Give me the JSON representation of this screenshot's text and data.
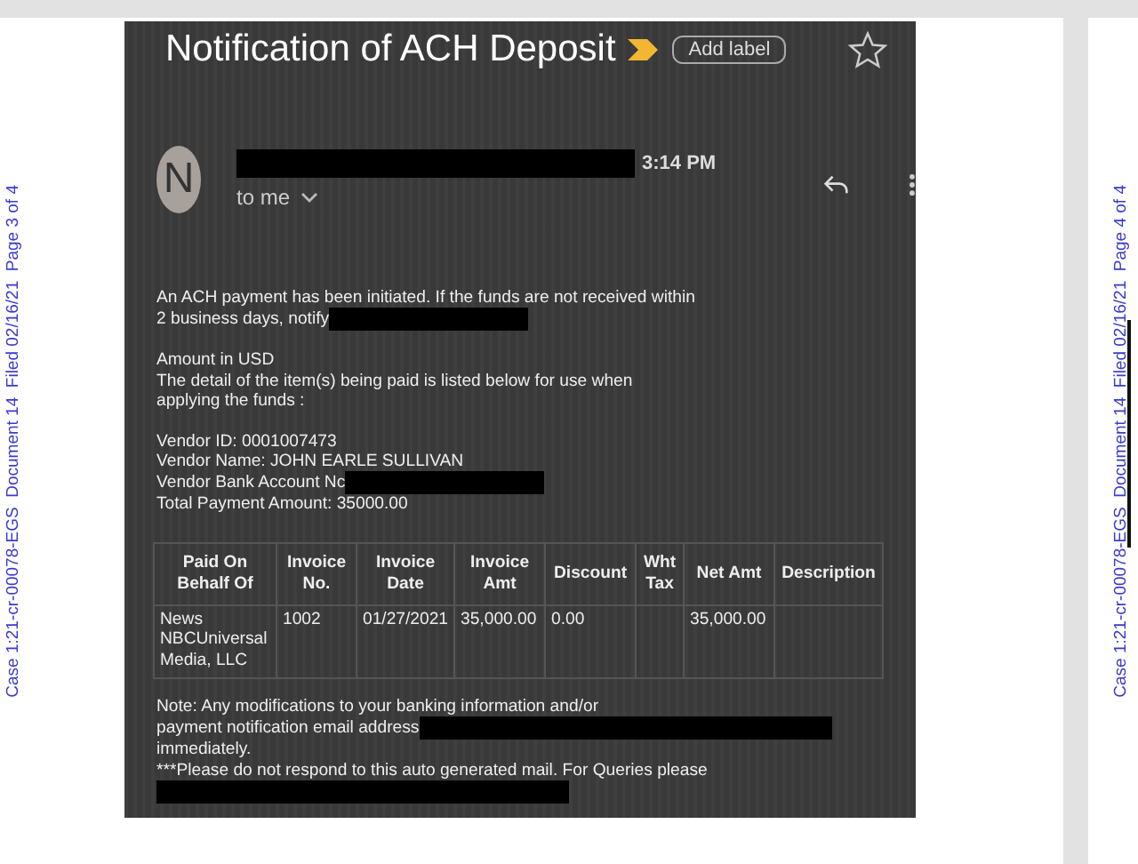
{
  "document": {
    "left_stamp": "Case 1:21-cr-00078-EGS  Document 14  Filed 02/16/21  Page 3 of 4",
    "right_stamp": "Case 1:21-cr-00078-EGS  Document 14  Filed 02/16/21  Page 4 of 4"
  },
  "email": {
    "subject": "Notification of ACH Deposit",
    "important": true,
    "label_button": "Add label",
    "starred": false,
    "avatar": "N",
    "sender_redacted": true,
    "time": "3:14 PM",
    "recipient": "to me",
    "paragraphs": [
      [
        {
          "text": "An ACH payment has been initiated. If the funds are not received within"
        },
        {
          "text": "2 business days, notify",
          "redacted": true
        }
      ],
      [
        {
          "text": "Amount in USD"
        },
        {
          "text": "The detail of the item(s) being paid is listed below for use when"
        },
        {
          "text": "applying the funds :"
        }
      ],
      [
        {
          "text": "Vendor ID: 0001007473"
        },
        {
          "text": "Vendor Name: JOHN EARLE SULLIVAN"
        },
        {
          "text": "Vendor Bank Account Nc",
          "redacted": true
        },
        {
          "text": "Total Payment Amount: 35000.00"
        }
      ]
    ],
    "table": {
      "columns": [
        "Paid On Behalf Of",
        "Invoice No.",
        "Invoice Date",
        "Invoice Amt",
        "Discount",
        "Wht Tax",
        "Net Amt",
        "Description"
      ],
      "rows": [
        [
          "News NBCUniversal Media, LLC",
          "1002",
          "01/27/2021",
          "35,000.00",
          "0.00",
          "",
          "35,000.00",
          ""
        ]
      ]
    },
    "note": [
      {
        "text": "Note: Any modifications to your banking information and/or"
      },
      {
        "text": "payment notification email address",
        "redacted": true
      },
      {
        "text": "immediately."
      },
      {
        "text": "***Please do not respond to this auto generated mail. For Queries please"
      },
      {
        "redacted": true
      }
    ]
  }
}
